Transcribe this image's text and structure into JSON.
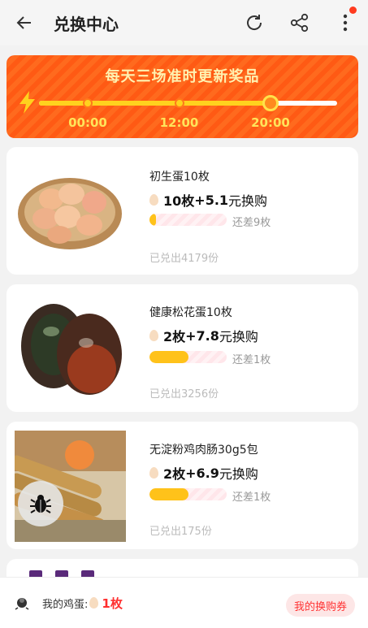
{
  "header": {
    "title": "兑换中心",
    "back_icon": "back-arrow-icon",
    "refresh_icon": "refresh-icon",
    "share_icon": "share-icon",
    "more_icon": "more-vertical-icon"
  },
  "banner": {
    "title": "每天三场准时更新奖品",
    "times": [
      "00:00",
      "12:00",
      "20:00"
    ],
    "active_index": 2
  },
  "products": [
    {
      "name": "初生蛋10枚",
      "price_eggs": "10枚",
      "price_cash": "+5.1",
      "price_suffix": "元换购",
      "progress": 0.08,
      "remaining": "还差9枚",
      "sold": "已兑出4179份"
    },
    {
      "name": "健康松花蛋10枚",
      "price_eggs": "2枚",
      "price_cash": "+7.8",
      "price_suffix": "元换购",
      "progress": 0.5,
      "remaining": "还差1枚",
      "sold": "已兑出3256份"
    },
    {
      "name": "无淀粉鸡肉肠30g5包",
      "price_eggs": "2枚",
      "price_cash": "+6.9",
      "price_suffix": "元换购",
      "progress": 0.5,
      "remaining": "还差1枚",
      "sold": "已兑出175份"
    }
  ],
  "bottom": {
    "label": "我的鸡蛋:",
    "count": "1枚",
    "button": "我的换购券"
  },
  "colors": {
    "accent": "#ff5a14",
    "progress_fill": "#ffc21a",
    "red": "#ff2e2e"
  }
}
